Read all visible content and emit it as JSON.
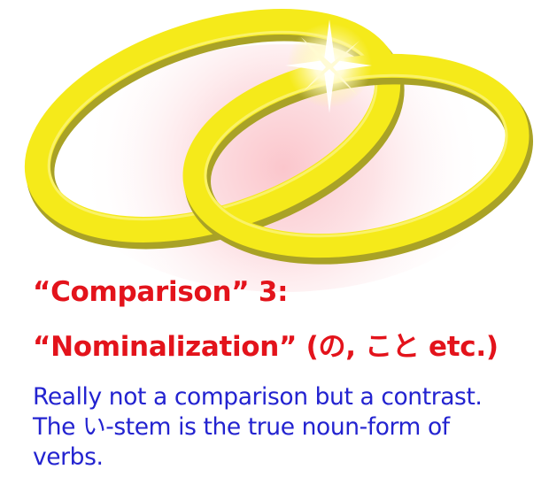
{
  "colors": {
    "title": "#e3131b",
    "body": "#2323d0",
    "ring": "#f5ea1a",
    "ring_shadow": "#b3ad25",
    "glow": "#fdd7dc"
  },
  "illustration": {
    "icon": "interlocked-gold-rings-icon",
    "sparkle_icon": "sparkle-icon"
  },
  "heading": {
    "line1": "“Comparison” 3:",
    "line2": "“Nominalization” (の, こと etc.)"
  },
  "body": {
    "text": "Really not a comparison but a contrast.\nThe い-stem is the true noun-form of\nverbs."
  }
}
